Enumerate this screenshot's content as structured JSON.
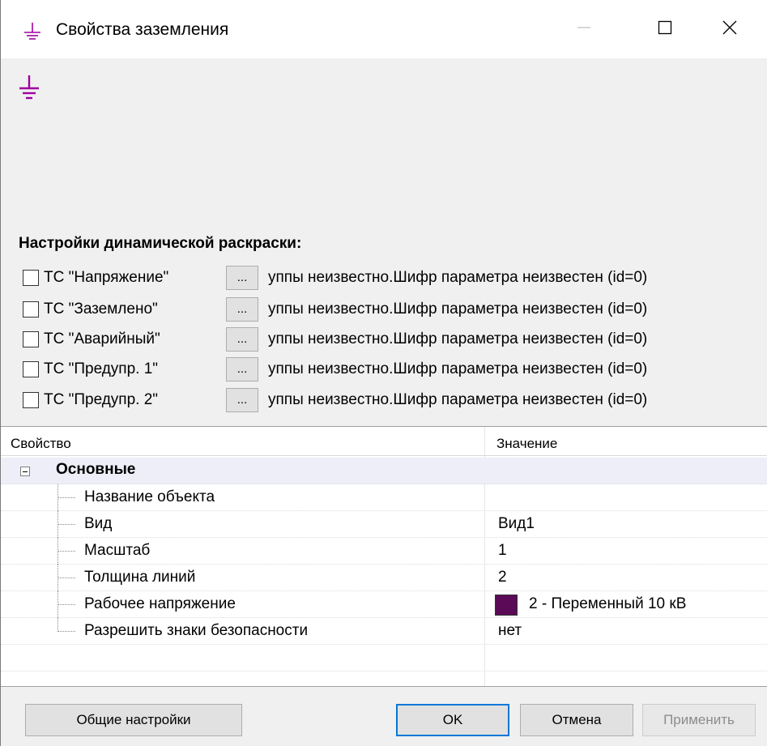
{
  "window": {
    "title": "Свойства заземления",
    "icon": "ground-icon",
    "accent_color": "#a000a0",
    "controls": {
      "minimize_icon": "minimize-icon",
      "maximize_icon": "maximize-icon",
      "close_icon": "close-icon"
    }
  },
  "preview": {
    "icon": "ground-symbol-icon"
  },
  "dynamic_coloring": {
    "title": "Настройки динамической раскраски:",
    "rows": [
      {
        "label": "ТС \"Напряжение\"",
        "checked": false,
        "button": "...",
        "description": "уппы неизвестно.Шифр параметра неизвестен (id=0)"
      },
      {
        "label": "ТС \"Заземлено\"",
        "checked": false,
        "button": "...",
        "description": "уппы неизвестно.Шифр параметра неизвестен (id=0)"
      },
      {
        "label": "ТС \"Аварийный\"",
        "checked": false,
        "button": "...",
        "description": "уппы неизвестно.Шифр параметра неизвестен (id=0)"
      },
      {
        "label": "ТС \"Предупр. 1\"",
        "checked": false,
        "button": "...",
        "description": "уппы неизвестно.Шифр параметра неизвестен (id=0)"
      },
      {
        "label": "ТС \"Предупр. 2\"",
        "checked": false,
        "button": "...",
        "description": "уппы неизвестно.Шифр параметра неизвестен (id=0)"
      }
    ]
  },
  "property_grid": {
    "header": {
      "property": "Свойство",
      "value": "Значение"
    },
    "category": {
      "label": "Основные",
      "expanded": true
    },
    "rows": [
      {
        "label": "Название объекта",
        "value": ""
      },
      {
        "label": "Вид",
        "value": "Вид1"
      },
      {
        "label": "Масштаб",
        "value": "1"
      },
      {
        "label": "Толщина линий",
        "value": "2"
      },
      {
        "label": "Рабочее напряжение",
        "value": "2 - Переменный 10 кВ",
        "swatch_color": "#5a0a57"
      },
      {
        "label": "Разрешить знаки безопасности",
        "value": "нет"
      }
    ]
  },
  "buttons": {
    "general": "Общие настройки",
    "ok": "OK",
    "cancel": "Отмена",
    "apply": "Применить"
  }
}
